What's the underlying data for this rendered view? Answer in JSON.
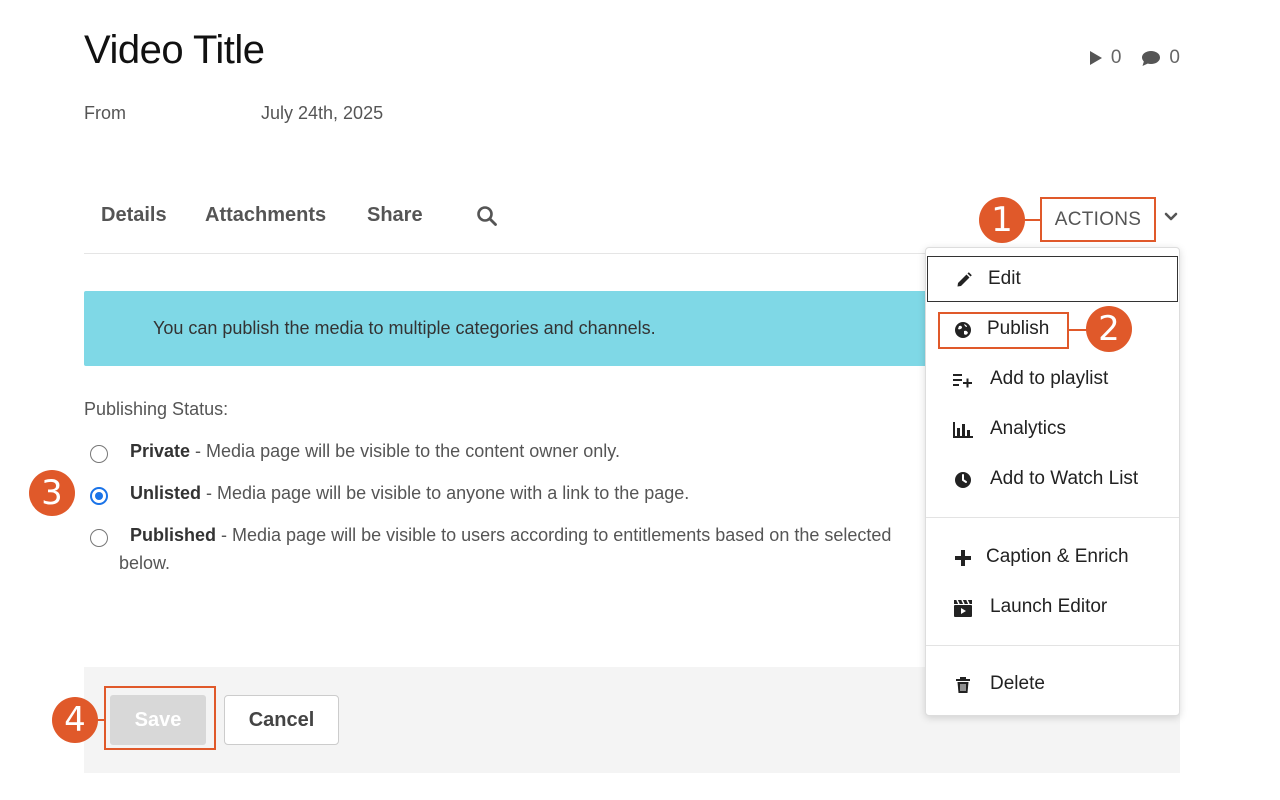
{
  "header": {
    "title": "Video Title",
    "plays": "0",
    "comments": "0",
    "from_label": "From",
    "date": "July 24th, 2025"
  },
  "tabs": [
    "Details",
    "Attachments",
    "Share"
  ],
  "actions": {
    "label": "ACTIONS"
  },
  "callouts": [
    "1",
    "2",
    "3",
    "4"
  ],
  "banner": {
    "text": "You can publish the media to multiple categories and channels."
  },
  "publishing": {
    "label": "Publishing Status:",
    "options": [
      {
        "name": "Private",
        "desc": " - Media page will be visible to the content owner only.",
        "checked": false
      },
      {
        "name": "Unlisted",
        "desc": " - Media page will be visible to anyone with a link to the page.",
        "checked": true
      },
      {
        "name": "Published",
        "desc": " - Media page will be visible to users according to entitlements based on the selected",
        "checked": false
      }
    ],
    "continuation": "below."
  },
  "footer": {
    "save": "Save",
    "cancel": "Cancel"
  },
  "menu": {
    "items": [
      {
        "label": "Edit",
        "icon": "pencil-icon"
      },
      {
        "label": "Publish",
        "icon": "globe-icon"
      },
      {
        "label": "Add to playlist",
        "icon": "add-to-playlist-icon"
      },
      {
        "label": "Analytics",
        "icon": "bar-chart-icon"
      },
      {
        "label": "Add to Watch List",
        "icon": "clock-icon"
      },
      {
        "label": "Caption & Enrich",
        "icon": "plus-icon"
      },
      {
        "label": "Launch Editor",
        "icon": "clapperboard-icon"
      },
      {
        "label": "Delete",
        "icon": "trash-icon"
      }
    ]
  },
  "colors": {
    "accent": "#e0592a",
    "banner": "#7fd8e6",
    "radio": "#1a73e8"
  }
}
